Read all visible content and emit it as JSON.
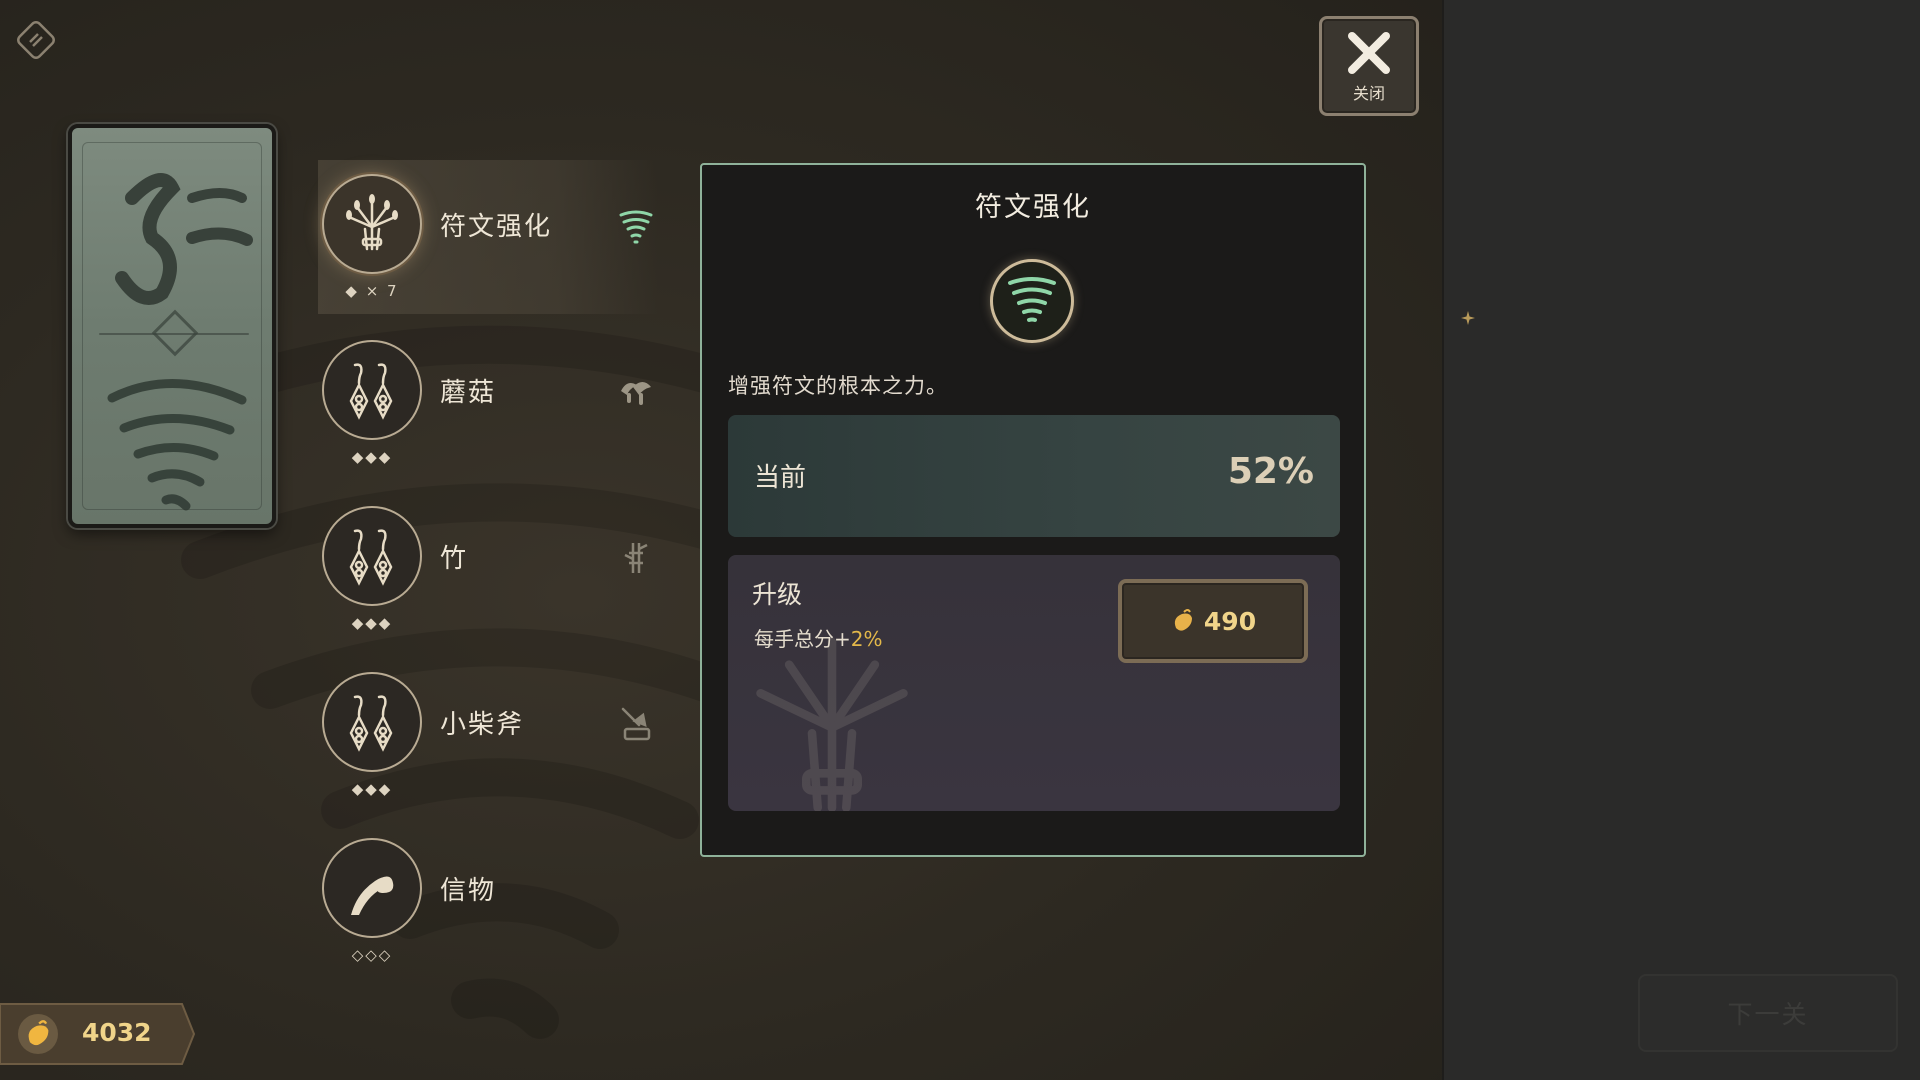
{
  "close_button": {
    "label": "关闭"
  },
  "skills": [
    {
      "name": "符文强化",
      "level": "◆ × 7",
      "icon": "wheat-bundle-icon",
      "mini_icon": "tornado-icon",
      "active": true
    },
    {
      "name": "蘑菇",
      "level": "◆◆◆",
      "icon": "earring-pair-icon",
      "mini_icon": "mushroom-icon",
      "active": false
    },
    {
      "name": "竹",
      "level": "◆◆◆",
      "icon": "earring-pair-icon",
      "mini_icon": "bamboo-icon",
      "active": false
    },
    {
      "name": "小柴斧",
      "level": "◆◆◆",
      "icon": "earring-pair-icon",
      "mini_icon": "axe-stump-icon",
      "active": false
    },
    {
      "name": "信物",
      "level": "◇◇◇",
      "icon": "feather-swirl-icon",
      "mini_icon": "",
      "active": false
    }
  ],
  "detail": {
    "title": "符文强化",
    "icon": "tornado-icon",
    "description": "增强符文的根本之力。",
    "current_label": "当前",
    "current_value": "52%",
    "upgrade_label": "升级",
    "upgrade_effect_prefix": "每手总分+",
    "upgrade_effect_value": "2%",
    "cost": "490",
    "cost_icon": "seed-coin-icon"
  },
  "currency": {
    "amount": "4032",
    "icon": "seed-coin-icon"
  },
  "next_button": {
    "label": "下一关"
  },
  "colors": {
    "accent_gold": "#f0d48a",
    "panel_border": "#8fb29a",
    "highlight_orange": "#e3b84a",
    "tornado_green": "#8fd6a8"
  }
}
